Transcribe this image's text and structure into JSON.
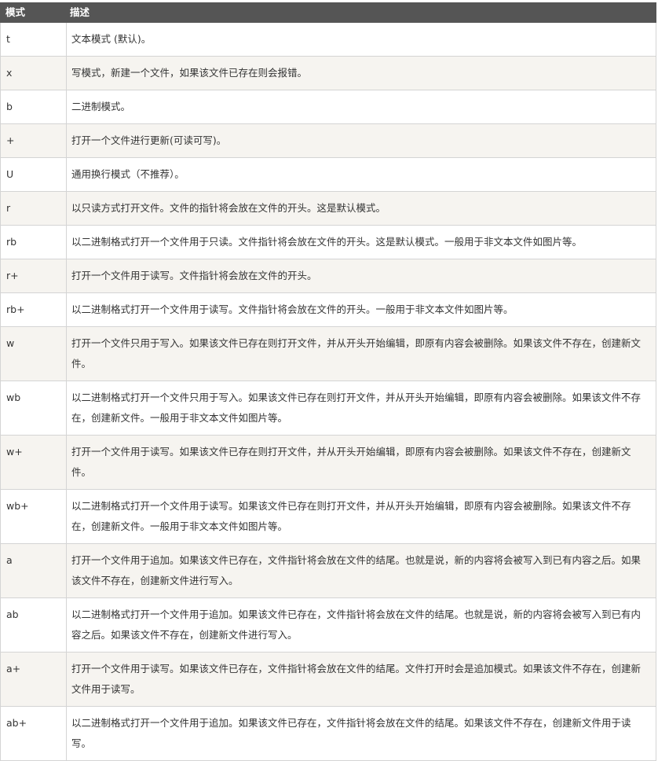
{
  "table": {
    "headers": [
      "模式",
      "描述"
    ],
    "rows": [
      {
        "mode": "t",
        "desc": "文本模式 (默认)。"
      },
      {
        "mode": "x",
        "desc": "写模式，新建一个文件，如果该文件已存在则会报错。"
      },
      {
        "mode": "b",
        "desc": "二进制模式。"
      },
      {
        "mode": "+",
        "desc": "打开一个文件进行更新(可读可写)。"
      },
      {
        "mode": "U",
        "desc": "通用换行模式（不推荐）。"
      },
      {
        "mode": "r",
        "desc": "以只读方式打开文件。文件的指针将会放在文件的开头。这是默认模式。"
      },
      {
        "mode": "rb",
        "desc": "以二进制格式打开一个文件用于只读。文件指针将会放在文件的开头。这是默认模式。一般用于非文本文件如图片等。"
      },
      {
        "mode": "r+",
        "desc": "打开一个文件用于读写。文件指针将会放在文件的开头。"
      },
      {
        "mode": "rb+",
        "desc": "以二进制格式打开一个文件用于读写。文件指针将会放在文件的开头。一般用于非文本文件如图片等。"
      },
      {
        "mode": "w",
        "desc": "打开一个文件只用于写入。如果该文件已存在则打开文件，并从开头开始编辑，即原有内容会被删除。如果该文件不存在，创建新文件。"
      },
      {
        "mode": "wb",
        "desc": "以二进制格式打开一个文件只用于写入。如果该文件已存在则打开文件，并从开头开始编辑，即原有内容会被删除。如果该文件不存在，创建新文件。一般用于非文本文件如图片等。"
      },
      {
        "mode": "w+",
        "desc": "打开一个文件用于读写。如果该文件已存在则打开文件，并从开头开始编辑，即原有内容会被删除。如果该文件不存在，创建新文件。"
      },
      {
        "mode": "wb+",
        "desc": "以二进制格式打开一个文件用于读写。如果该文件已存在则打开文件，并从开头开始编辑，即原有内容会被删除。如果该文件不存在，创建新文件。一般用于非文本文件如图片等。"
      },
      {
        "mode": "a",
        "desc": "打开一个文件用于追加。如果该文件已存在，文件指针将会放在文件的结尾。也就是说，新的内容将会被写入到已有内容之后。如果该文件不存在，创建新文件进行写入。"
      },
      {
        "mode": "ab",
        "desc": "以二进制格式打开一个文件用于追加。如果该文件已存在，文件指针将会放在文件的结尾。也就是说，新的内容将会被写入到已有内容之后。如果该文件不存在，创建新文件进行写入。"
      },
      {
        "mode": "a+",
        "desc": "打开一个文件用于读写。如果该文件已存在，文件指针将会放在文件的结尾。文件打开时会是追加模式。如果该文件不存在，创建新文件用于读写。"
      },
      {
        "mode": "ab+",
        "desc": "以二进制格式打开一个文件用于追加。如果该文件已存在，文件指针将会放在文件的结尾。如果该文件不存在，创建新文件用于读写。"
      }
    ]
  }
}
